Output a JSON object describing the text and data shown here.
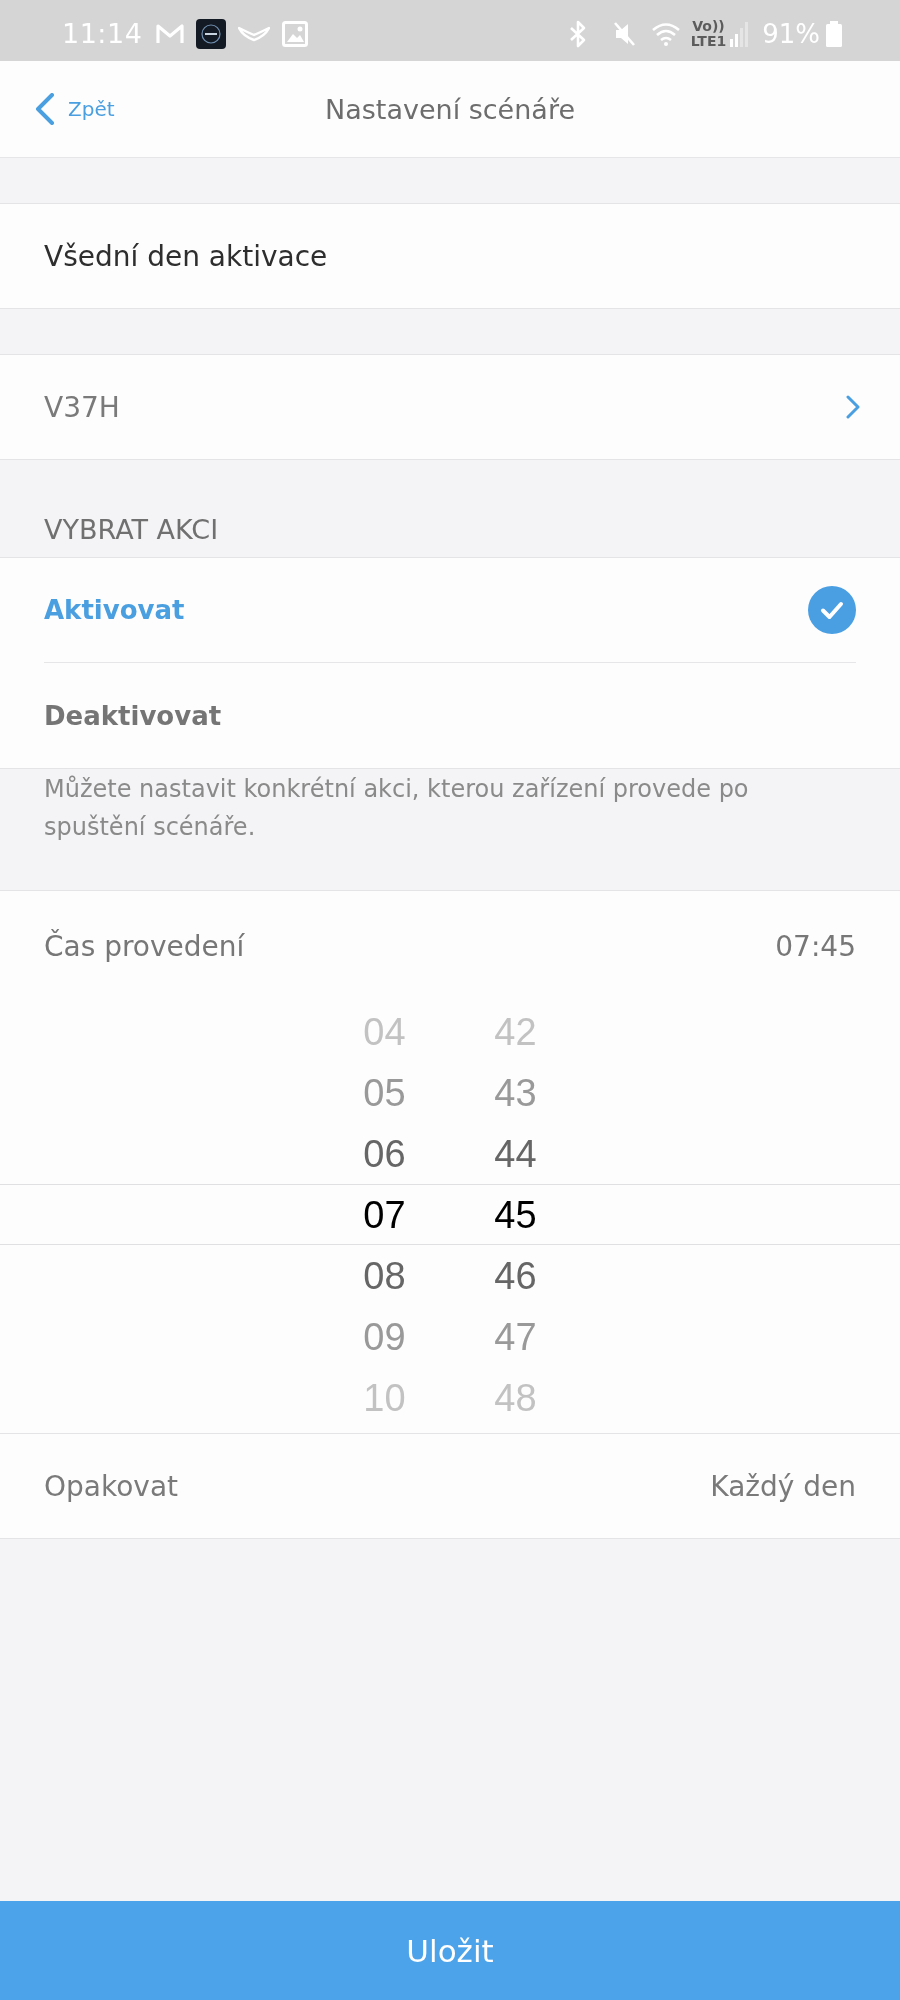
{
  "status_bar": {
    "time": "11:14",
    "volte": "Vo))",
    "network": "LTE1",
    "battery_text": "91%"
  },
  "header": {
    "back_label": "Zpět",
    "title": "Nastavení scénáře"
  },
  "scenario_name": {
    "label": "Všední den aktivace"
  },
  "device": {
    "label": "V37H"
  },
  "action_section": {
    "heading": "VYBRAT AKCI",
    "options": [
      {
        "label": "Aktivovat",
        "selected": true
      },
      {
        "label": "Deaktivovat",
        "selected": false
      }
    ],
    "note": "Můžete nastavit konkrétní akci, kterou zařízení provede po spuštění scénáře."
  },
  "execution_time": {
    "label": "Čas provedení",
    "value": "07:45",
    "hours": [
      {
        "label": "04",
        "selected": false
      },
      {
        "label": "05",
        "selected": false
      },
      {
        "label": "06",
        "selected": false
      },
      {
        "label": "07",
        "selected": true
      },
      {
        "label": "08",
        "selected": false
      },
      {
        "label": "09",
        "selected": false
      },
      {
        "label": "10",
        "selected": false
      }
    ],
    "minutes": [
      {
        "label": "42",
        "selected": false
      },
      {
        "label": "43",
        "selected": false
      },
      {
        "label": "44",
        "selected": false
      },
      {
        "label": "45",
        "selected": true
      },
      {
        "label": "46",
        "selected": false
      },
      {
        "label": "47",
        "selected": false
      },
      {
        "label": "48",
        "selected": false
      }
    ]
  },
  "repeat": {
    "label": "Opakovat",
    "value": "Každý den"
  },
  "save_button": {
    "label": "Uložit"
  }
}
